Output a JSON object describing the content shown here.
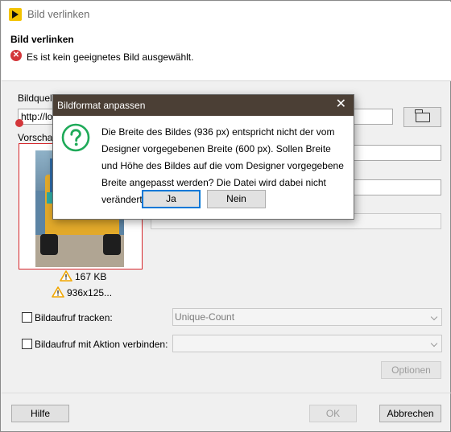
{
  "window": {
    "title": "Bild verlinken"
  },
  "header": {
    "title": "Bild verlinken",
    "error_text": "Es ist kein geeignetes Bild ausgewählt."
  },
  "form": {
    "source_label": "Bildquelle",
    "source_value": "http://lo",
    "preview_label": "Vorschau",
    "file_size": "167 KB",
    "dimensions": "936x125..."
  },
  "options": {
    "track_label": "Bildaufruf tracken:",
    "track_value": "Unique-Count",
    "action_label": "Bildaufruf mit Aktion verbinden:",
    "action_value": "",
    "options_button": "Optionen"
  },
  "footer": {
    "help": "Hilfe",
    "ok": "OK",
    "cancel": "Abbrechen"
  },
  "modal": {
    "title": "Bildformat anpassen",
    "message": "Die Breite des Bildes (936 px) entspricht nicht der vom Designer vorgegebenen Breite (600 px). Sollen Breite und Höhe des Bildes auf die vom Designer vorgegebene Breite angepasst werden? Die Datei wird dabei nicht verändert.",
    "yes": "Ja",
    "no": "Nein",
    "close_glyph": "✕"
  },
  "colors": {
    "modal_titlebar": "#4b3f35",
    "error": "#d3363a",
    "question_icon": "#1faa59",
    "warning": "#f0a500"
  }
}
